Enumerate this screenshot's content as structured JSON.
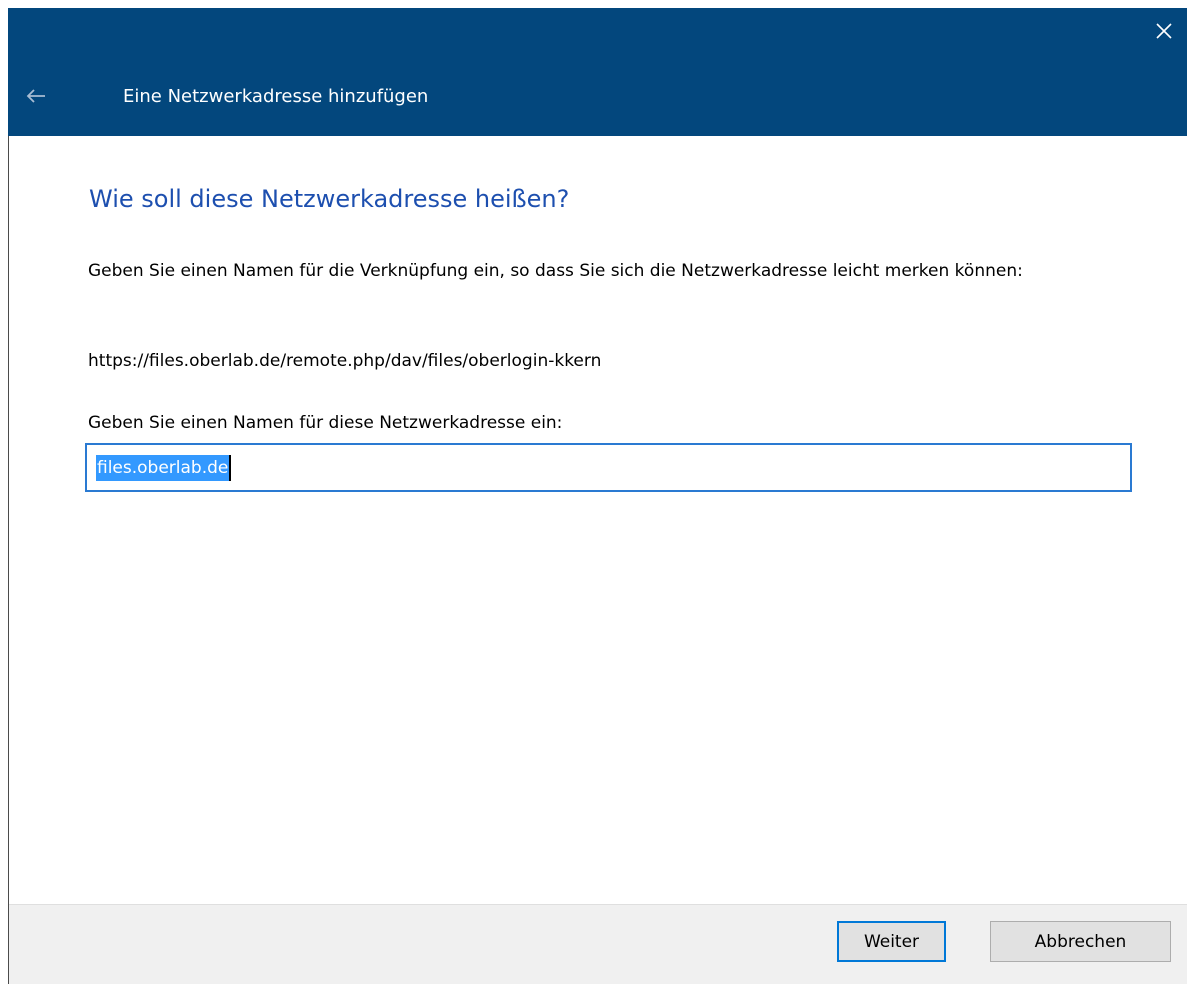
{
  "titlebar": {
    "title": "Eine Netzwerkadresse hinzufügen",
    "back_icon": "arrow-left-icon",
    "close_icon": "close-icon",
    "accent_color": "#03477d"
  },
  "main": {
    "heading": "Wie soll diese Netzwerkadresse heißen?",
    "description": "Geben Sie einen Namen für die Verknüpfung ein, so dass Sie sich die Netzwerkadresse leicht merken können:",
    "url": "https://files.oberlab.de/remote.php/dav/files/oberlogin-kkern",
    "field_label": "Geben Sie einen Namen für diese Netzwerkadresse ein:",
    "name_value": "files.oberlab.de",
    "heading_color": "#1d4faf"
  },
  "footer": {
    "next_label": "Weiter",
    "cancel_label": "Abbrechen"
  }
}
